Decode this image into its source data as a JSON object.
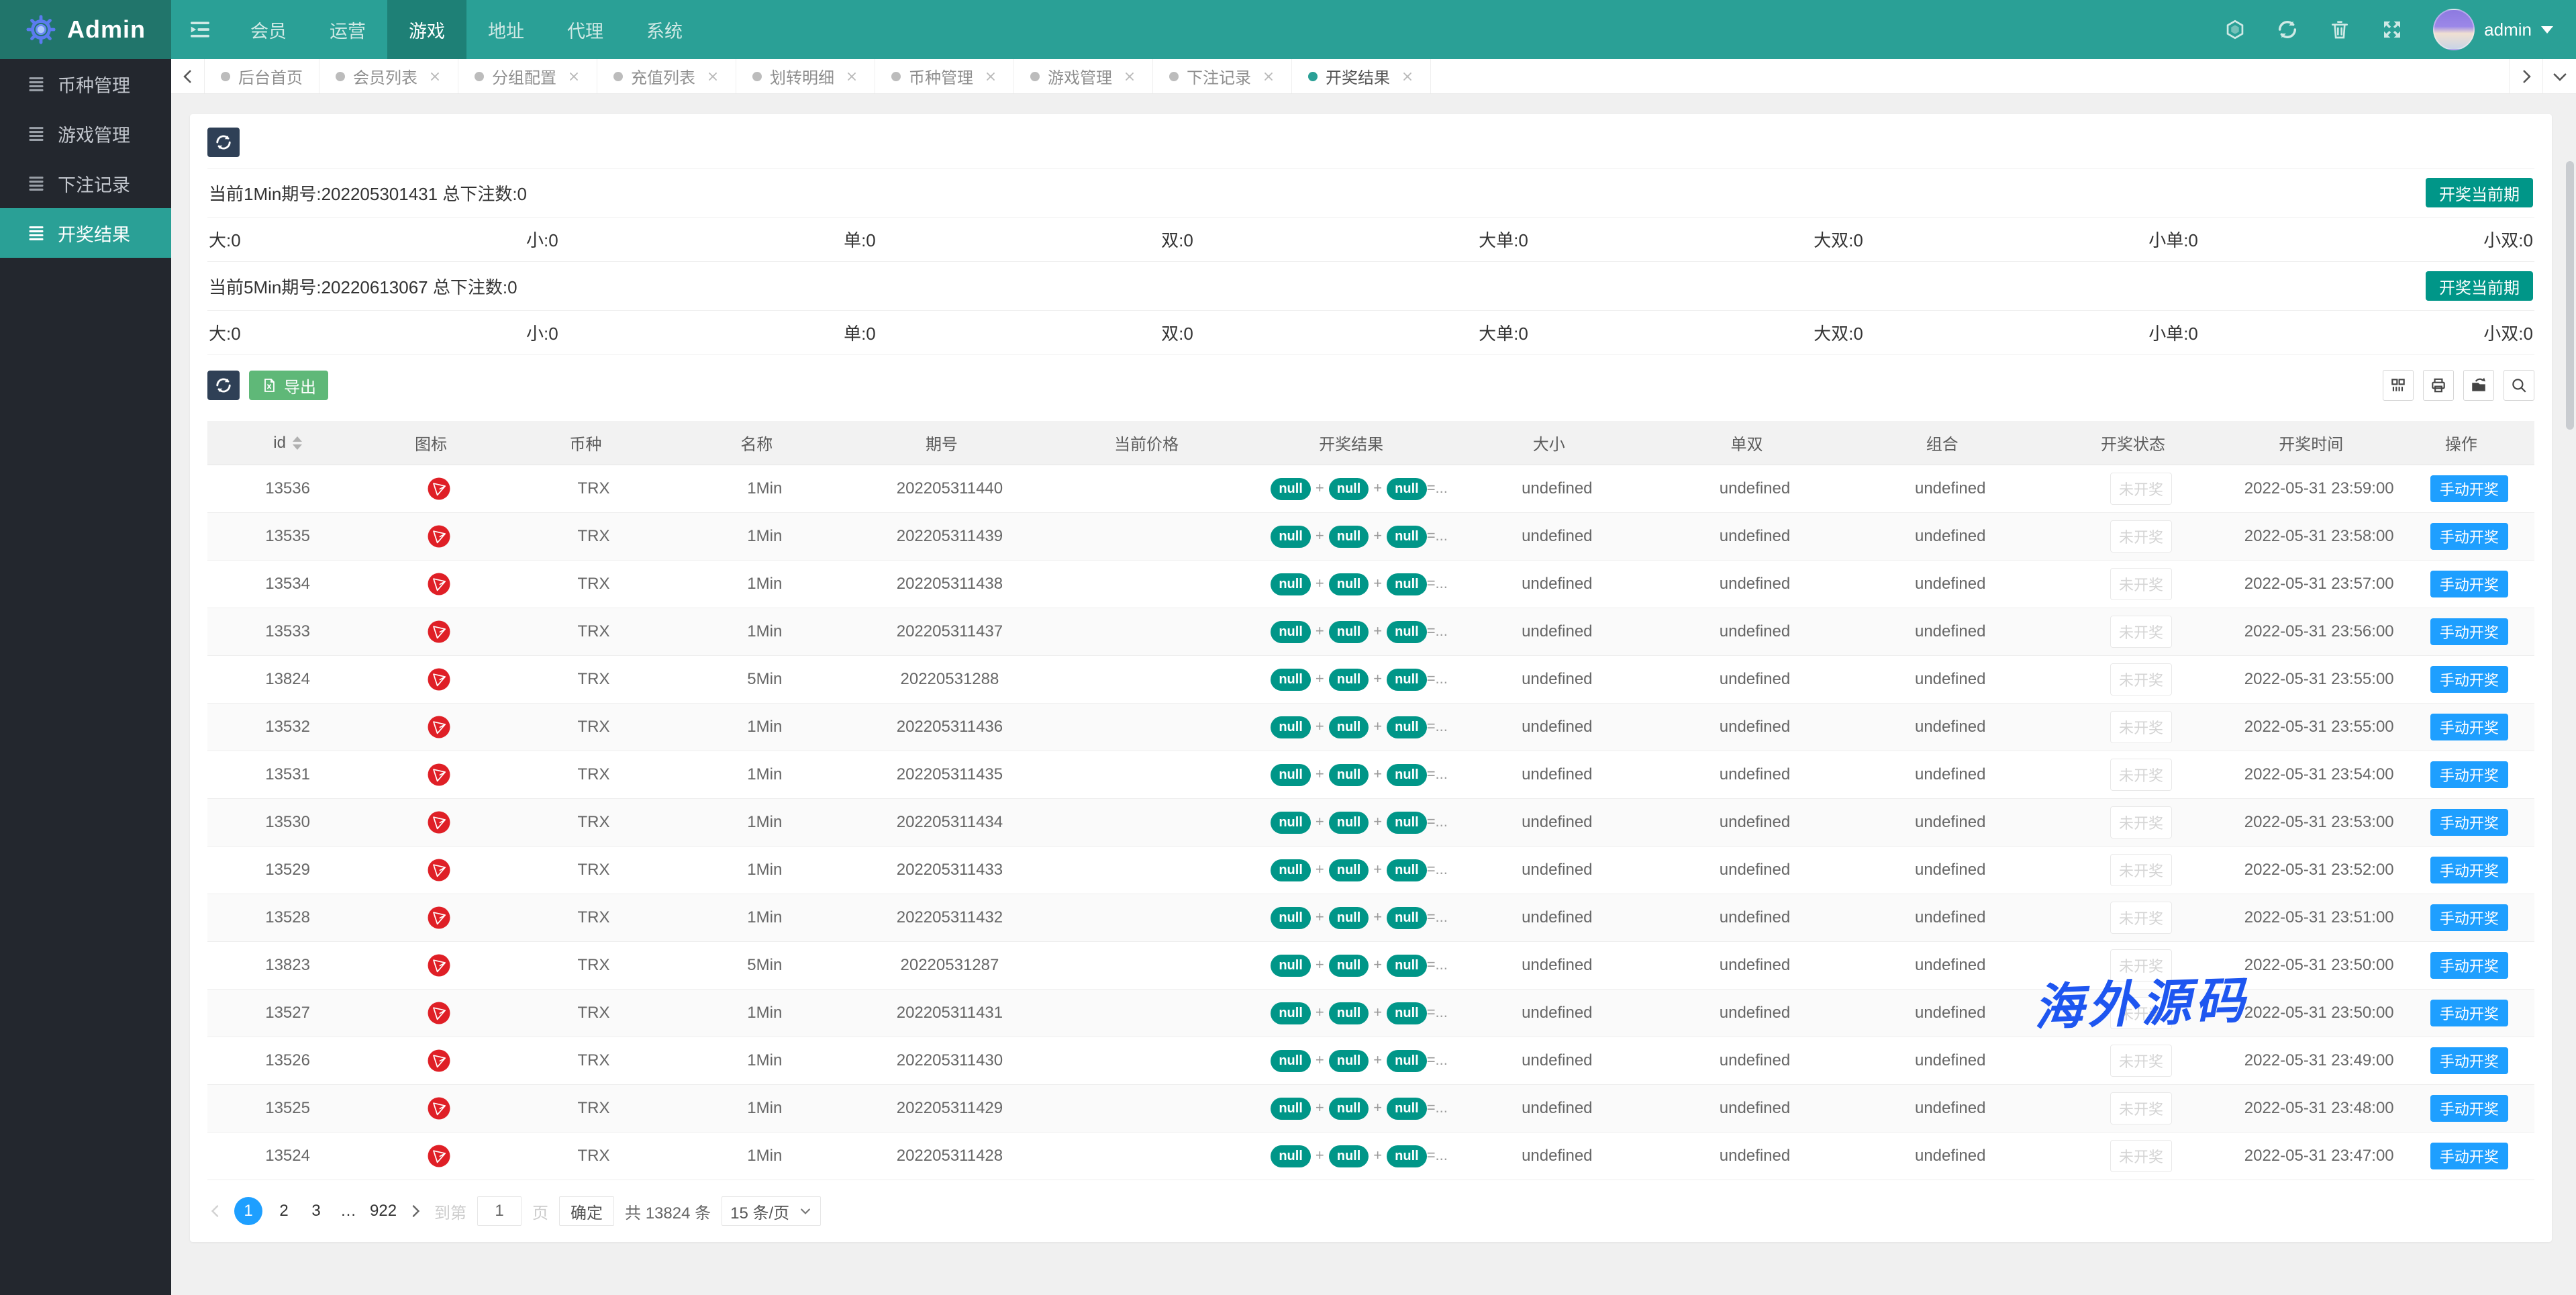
{
  "header": {
    "brand": "Admin",
    "nav": [
      {
        "label": "会员",
        "active": false
      },
      {
        "label": "运营",
        "active": false
      },
      {
        "label": "游戏",
        "active": true
      },
      {
        "label": "地址",
        "active": false
      },
      {
        "label": "代理",
        "active": false
      },
      {
        "label": "系统",
        "active": false
      }
    ],
    "username": "admin"
  },
  "tabs": [
    {
      "label": "后台首页",
      "active": false,
      "closable": false
    },
    {
      "label": "会员列表",
      "active": false,
      "closable": true
    },
    {
      "label": "分组配置",
      "active": false,
      "closable": true
    },
    {
      "label": "充值列表",
      "active": false,
      "closable": true
    },
    {
      "label": "划转明细",
      "active": false,
      "closable": true
    },
    {
      "label": "币种管理",
      "active": false,
      "closable": true
    },
    {
      "label": "游戏管理",
      "active": false,
      "closable": true
    },
    {
      "label": "下注记录",
      "active": false,
      "closable": true
    },
    {
      "label": "开奖结果",
      "active": true,
      "closable": true
    }
  ],
  "sidebar": [
    {
      "label": "币种管理",
      "active": false
    },
    {
      "label": "游戏管理",
      "active": false
    },
    {
      "label": "下注记录",
      "active": false
    },
    {
      "label": "开奖结果",
      "active": true
    }
  ],
  "panel": {
    "periods": [
      {
        "title": "当前1Min期号:202205301431 总下注数:0",
        "button": "开奖当前期"
      },
      {
        "title": "当前5Min期号:20220613067 总下注数:0",
        "button": "开奖当前期"
      }
    ],
    "stats": [
      "大:0",
      "小:0",
      "单:0",
      "双:0",
      "大单:0",
      "大双:0",
      "小单:0",
      "小双:0"
    ]
  },
  "toolbar": {
    "export_label": "导出"
  },
  "table": {
    "columns": [
      {
        "label": "id",
        "sortable": true
      },
      {
        "label": "图标",
        "sortable": false
      },
      {
        "label": "币种",
        "sortable": false
      },
      {
        "label": "名称",
        "sortable": false
      },
      {
        "label": "期号",
        "sortable": false
      },
      {
        "label": "当前价格",
        "sortable": false
      },
      {
        "label": "开奖结果",
        "sortable": false
      },
      {
        "label": "大小",
        "sortable": false
      },
      {
        "label": "单双",
        "sortable": false
      },
      {
        "label": "组合",
        "sortable": false
      },
      {
        "label": "开奖状态",
        "sortable": false
      },
      {
        "label": "开奖时间",
        "sortable": false
      },
      {
        "label": "操作",
        "sortable": false
      }
    ],
    "pill": "null",
    "plus": "+",
    "suffix": "=...",
    "status": "未开奖",
    "action": "手动开奖",
    "rows": [
      {
        "id": "13536",
        "coin": "TRX",
        "name": "1Min",
        "period": "202205311440",
        "price": "",
        "size": "undefined",
        "parity": "undefined",
        "combo": "undefined",
        "time": "2022-05-31 23:59:00"
      },
      {
        "id": "13535",
        "coin": "TRX",
        "name": "1Min",
        "period": "202205311439",
        "price": "",
        "size": "undefined",
        "parity": "undefined",
        "combo": "undefined",
        "time": "2022-05-31 23:58:00"
      },
      {
        "id": "13534",
        "coin": "TRX",
        "name": "1Min",
        "period": "202205311438",
        "price": "",
        "size": "undefined",
        "parity": "undefined",
        "combo": "undefined",
        "time": "2022-05-31 23:57:00"
      },
      {
        "id": "13533",
        "coin": "TRX",
        "name": "1Min",
        "period": "202205311437",
        "price": "",
        "size": "undefined",
        "parity": "undefined",
        "combo": "undefined",
        "time": "2022-05-31 23:56:00"
      },
      {
        "id": "13824",
        "coin": "TRX",
        "name": "5Min",
        "period": "20220531288",
        "price": "",
        "size": "undefined",
        "parity": "undefined",
        "combo": "undefined",
        "time": "2022-05-31 23:55:00"
      },
      {
        "id": "13532",
        "coin": "TRX",
        "name": "1Min",
        "period": "202205311436",
        "price": "",
        "size": "undefined",
        "parity": "undefined",
        "combo": "undefined",
        "time": "2022-05-31 23:55:00"
      },
      {
        "id": "13531",
        "coin": "TRX",
        "name": "1Min",
        "period": "202205311435",
        "price": "",
        "size": "undefined",
        "parity": "undefined",
        "combo": "undefined",
        "time": "2022-05-31 23:54:00"
      },
      {
        "id": "13530",
        "coin": "TRX",
        "name": "1Min",
        "period": "202205311434",
        "price": "",
        "size": "undefined",
        "parity": "undefined",
        "combo": "undefined",
        "time": "2022-05-31 23:53:00"
      },
      {
        "id": "13529",
        "coin": "TRX",
        "name": "1Min",
        "period": "202205311433",
        "price": "",
        "size": "undefined",
        "parity": "undefined",
        "combo": "undefined",
        "time": "2022-05-31 23:52:00"
      },
      {
        "id": "13528",
        "coin": "TRX",
        "name": "1Min",
        "period": "202205311432",
        "price": "",
        "size": "undefined",
        "parity": "undefined",
        "combo": "undefined",
        "time": "2022-05-31 23:51:00"
      },
      {
        "id": "13823",
        "coin": "TRX",
        "name": "5Min",
        "period": "20220531287",
        "price": "",
        "size": "undefined",
        "parity": "undefined",
        "combo": "undefined",
        "time": "2022-05-31 23:50:00"
      },
      {
        "id": "13527",
        "coin": "TRX",
        "name": "1Min",
        "period": "202205311431",
        "price": "",
        "size": "undefined",
        "parity": "undefined",
        "combo": "undefined",
        "time": "2022-05-31 23:50:00"
      },
      {
        "id": "13526",
        "coin": "TRX",
        "name": "1Min",
        "period": "202205311430",
        "price": "",
        "size": "undefined",
        "parity": "undefined",
        "combo": "undefined",
        "time": "2022-05-31 23:49:00"
      },
      {
        "id": "13525",
        "coin": "TRX",
        "name": "1Min",
        "period": "202205311429",
        "price": "",
        "size": "undefined",
        "parity": "undefined",
        "combo": "undefined",
        "time": "2022-05-31 23:48:00"
      },
      {
        "id": "13524",
        "coin": "TRX",
        "name": "1Min",
        "period": "202205311428",
        "price": "",
        "size": "undefined",
        "parity": "undefined",
        "combo": "undefined",
        "time": "2022-05-31 23:47:00"
      }
    ]
  },
  "pagination": {
    "pages": [
      {
        "label": "1",
        "active": true
      },
      {
        "label": "2",
        "active": false
      },
      {
        "label": "3",
        "active": false
      },
      {
        "label": "…",
        "active": false
      },
      {
        "label": "922",
        "active": false
      }
    ],
    "jump_label": "到第",
    "jump_value": "1",
    "page_word": "页",
    "confirm": "确定",
    "total": "共 13824 条",
    "per_page": "15 条/页"
  },
  "watermark": "海外源码",
  "colors": {
    "header_teal": "#2aa096",
    "logo_teal": "#21756b",
    "nav_active_teal": "#1e8076",
    "sidebar_dark": "#23272e",
    "button_dark": "#2f4056",
    "export_green": "#5FB878",
    "draw_teal": "#009688",
    "action_blue": "#1E9FFF",
    "trx_red": "#df1f26",
    "watermark_blue": "#1e56f0"
  }
}
